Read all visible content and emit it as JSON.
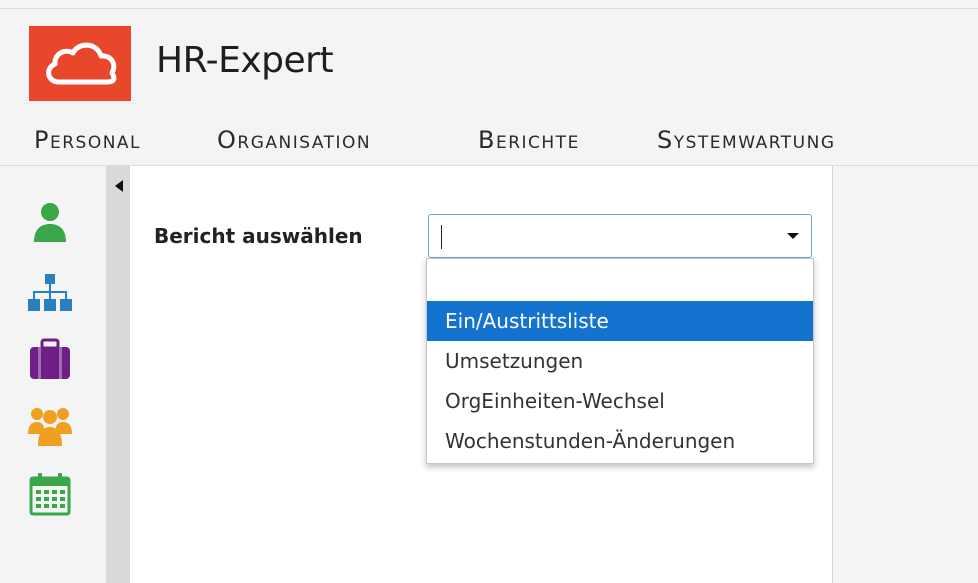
{
  "app": {
    "title": "HR-Expert",
    "brand_color": "#e8472b"
  },
  "menu": {
    "items": [
      {
        "label": "Personal"
      },
      {
        "label": "Organisation"
      },
      {
        "label": "Berichte"
      },
      {
        "label": "Systemwartung"
      }
    ]
  },
  "sidebar": {
    "icons": [
      {
        "name": "person-icon",
        "color": "#3aa64a"
      },
      {
        "name": "org-chart-icon",
        "color": "#2a7fc1"
      },
      {
        "name": "briefcase-icon",
        "color": "#6e1f86"
      },
      {
        "name": "group-icon",
        "color": "#f0a020"
      },
      {
        "name": "calendar-icon",
        "color": "#3aa64a"
      }
    ]
  },
  "report": {
    "label": "Bericht auswählen",
    "value": "",
    "options": [
      {
        "label": "",
        "selected": false
      },
      {
        "label": "Ein/Austrittsliste",
        "selected": true
      },
      {
        "label": "Umsetzungen",
        "selected": false
      },
      {
        "label": "OrgEinheiten-Wechsel",
        "selected": false
      },
      {
        "label": "Wochenstunden-Änderungen",
        "selected": false
      }
    ]
  },
  "colors": {
    "selection": "#1473cf",
    "select_border": "#6aa6d6"
  }
}
